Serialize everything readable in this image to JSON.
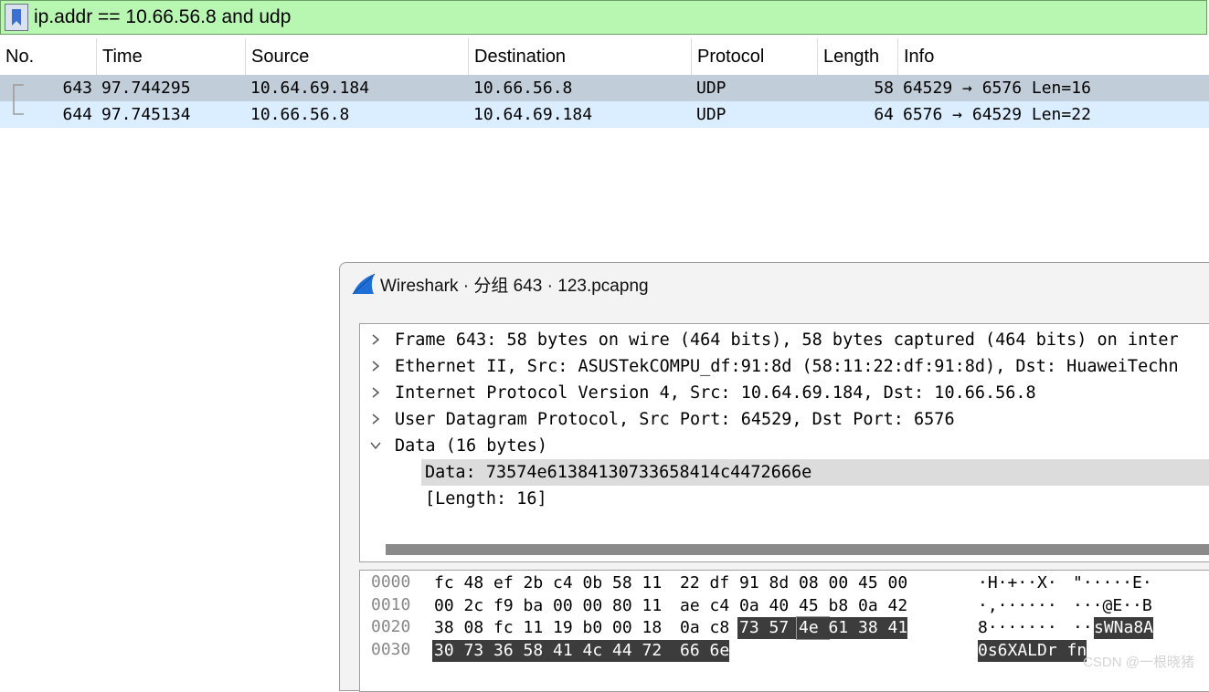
{
  "filter": {
    "text": "ip.addr == 10.66.56.8 and udp"
  },
  "packet_list": {
    "columns": [
      "No.",
      "Time",
      "Source",
      "Destination",
      "Protocol",
      "Length",
      "Info"
    ],
    "rows": [
      {
        "no": "643",
        "time": "97.744295",
        "source": "10.64.69.184",
        "destination": "10.66.56.8",
        "protocol": "UDP",
        "length": "58",
        "info": "64529 → 6576 Len=16"
      },
      {
        "no": "644",
        "time": "97.745134",
        "source": "10.66.56.8",
        "destination": "10.64.69.184",
        "protocol": "UDP",
        "length": "64",
        "info": "6576 → 64529 Len=22"
      }
    ],
    "colors": {
      "row_selected": "#c1cdd8",
      "row_udp": "#daeeff"
    }
  },
  "dialog": {
    "title": "Wireshark · 分组 643 · 123.pcapng",
    "tree": [
      {
        "text": "Frame 643: 58 bytes on wire (464 bits), 58 bytes captured (464 bits) on inter",
        "toggle": "collapsed"
      },
      {
        "text": "Ethernet II, Src: ASUSTekCOMPU_df:91:8d (58:11:22:df:91:8d), Dst: HuaweiTechn",
        "toggle": "collapsed"
      },
      {
        "text": "Internet Protocol Version 4, Src: 10.64.69.184, Dst: 10.66.56.8",
        "toggle": "collapsed"
      },
      {
        "text": "User Datagram Protocol, Src Port: 64529, Dst Port: 6576",
        "toggle": "collapsed"
      },
      {
        "text": "Data (16 bytes)",
        "toggle": "expanded"
      },
      {
        "text": "Data: 73574e61384130733658414c4472666e",
        "toggle": "none",
        "selected": true
      },
      {
        "text": "[Length: 16]",
        "toggle": "none"
      }
    ],
    "hex": [
      {
        "offset": "0000",
        "bytes": [
          "fc",
          "48",
          "ef",
          "2b",
          "c4",
          "0b",
          "58",
          "11",
          "22",
          "df",
          "91",
          "8d",
          "08",
          "00",
          "45",
          "00"
        ],
        "ascii": "·H·+··X·\"·····E·"
      },
      {
        "offset": "0010",
        "bytes": [
          "00",
          "2c",
          "f9",
          "ba",
          "00",
          "00",
          "80",
          "11",
          "ae",
          "c4",
          "0a",
          "40",
          "45",
          "b8",
          "0a",
          "42"
        ],
        "ascii": "·,······  ··@E··B"
      },
      {
        "offset": "0020",
        "bytes": [
          "38",
          "08",
          "fc",
          "11",
          "19",
          "b0",
          "00",
          "18",
          "0a",
          "c8",
          "73",
          "57",
          "4e",
          "61",
          "38",
          "41"
        ],
        "ascii": "8·······  ··sWNa8A"
      },
      {
        "offset": "0030",
        "bytes": [
          "30",
          "73",
          "36",
          "58",
          "41",
          "4c",
          "44",
          "72",
          "66",
          "6e"
        ],
        "ascii": "0s6XALDr fn"
      }
    ],
    "hex_ascii_rows": [
      {
        "pre": "·H·+··X·",
        "post": "\"·····E·",
        "hl": ""
      },
      {
        "pre": "·,······",
        "post": "···@E··B",
        "hl": ""
      },
      {
        "pre": "8·······",
        "post": "··",
        "hl": "sWNa8A"
      },
      {
        "pre": "",
        "post": "",
        "hl": "0s6XALDr fn"
      }
    ],
    "highlight": {
      "start_index": 42,
      "length": 16
    },
    "colors": {
      "highlight_bg": "#3c3c3c"
    }
  },
  "watermark": "CSDN @一根晓猪"
}
